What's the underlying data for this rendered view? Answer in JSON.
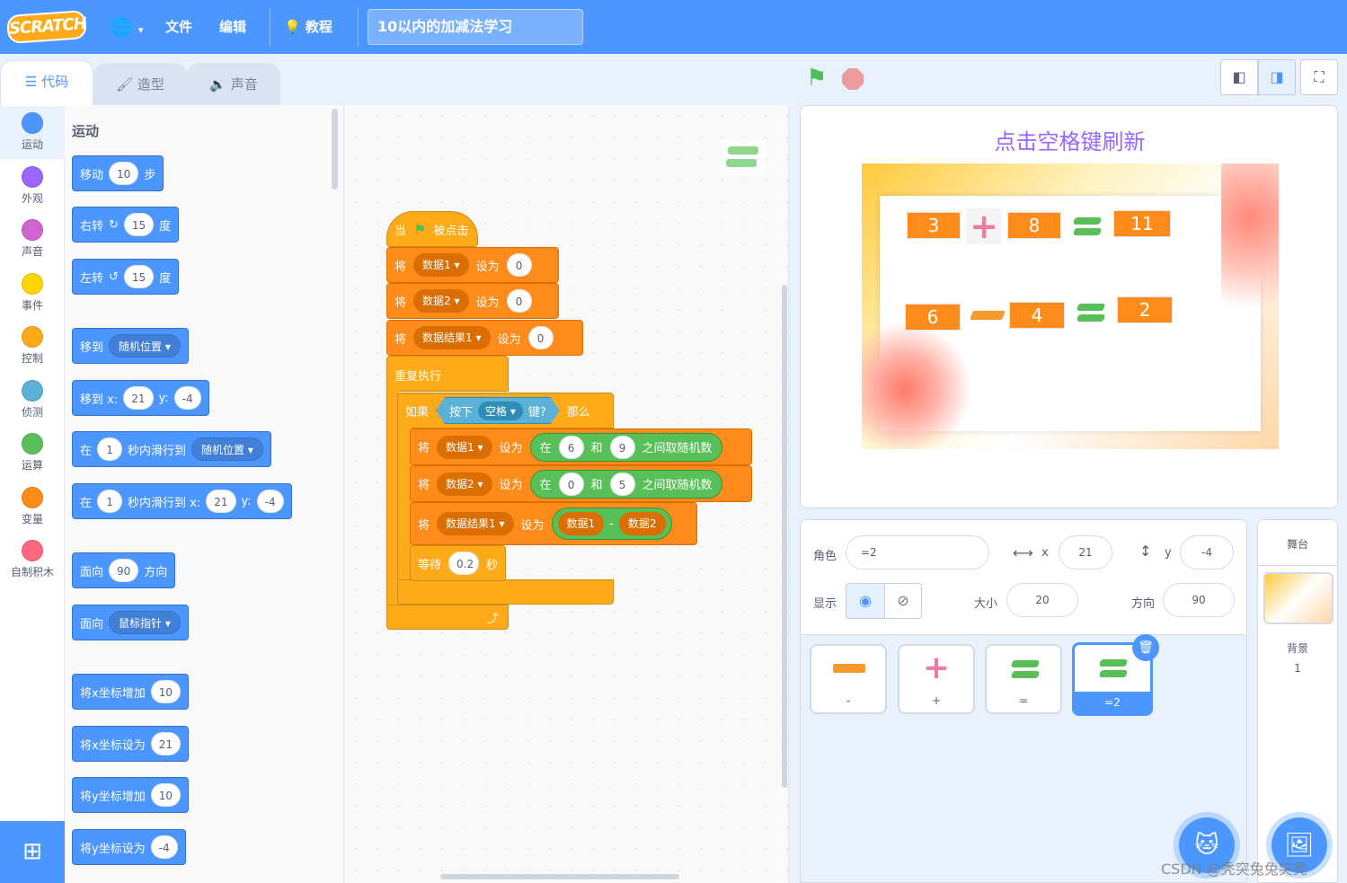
{
  "menu": {
    "logo": "SCRATCH",
    "file": "文件",
    "edit": "编辑",
    "tutorials": "教程",
    "project_title": "10以内的加减法学习"
  },
  "tabs": {
    "code": "代码",
    "costumes": "造型",
    "sounds": "声音"
  },
  "categories": [
    {
      "label": "运动",
      "color": "#4c97ff"
    },
    {
      "label": "外观",
      "color": "#9966ff"
    },
    {
      "label": "声音",
      "color": "#cf63cf"
    },
    {
      "label": "事件",
      "color": "#ffd500"
    },
    {
      "label": "控制",
      "color": "#ffab19"
    },
    {
      "label": "侦测",
      "color": "#5cb1d6"
    },
    {
      "label": "运算",
      "color": "#59c059"
    },
    {
      "label": "变量",
      "color": "#ff8c1a"
    },
    {
      "label": "自制积木",
      "color": "#ff6680"
    }
  ],
  "palette": {
    "title": "运动",
    "move": {
      "a": "移动",
      "v": "10",
      "b": "步"
    },
    "turn_right": {
      "a": "右转",
      "v": "15",
      "b": "度"
    },
    "turn_left": {
      "a": "左转",
      "v": "15",
      "b": "度"
    },
    "goto": {
      "a": "移到",
      "d": "随机位置"
    },
    "goto_xy": {
      "a": "移到 x:",
      "x": "21",
      "b": "y:",
      "y": "-4"
    },
    "glide": {
      "a": "在",
      "v": "1",
      "b": "秒内滑行到",
      "d": "随机位置"
    },
    "glide_xy": {
      "a": "在",
      "v": "1",
      "b": "秒内滑行到 x:",
      "x": "21",
      "c": "y:",
      "y": "-4"
    },
    "point_dir": {
      "a": "面向",
      "v": "90",
      "b": "方向"
    },
    "point_towards": {
      "a": "面向",
      "d": "鼠标指针"
    },
    "change_x": {
      "a": "将x坐标增加",
      "v": "10"
    },
    "set_x": {
      "a": "将x坐标设为",
      "v": "21"
    },
    "change_y": {
      "a": "将y坐标增加",
      "v": "10"
    },
    "set_y": {
      "a": "将y坐标设为",
      "v": "-4"
    }
  },
  "script": {
    "hat": {
      "a": "当",
      "b": "被点击"
    },
    "set1": {
      "a": "将",
      "var": "数据1",
      "b": "设为",
      "v": "0"
    },
    "set2": {
      "a": "将",
      "var": "数据2",
      "b": "设为",
      "v": "0"
    },
    "set3": {
      "a": "将",
      "var": "数据结果1",
      "b": "设为",
      "v": "0"
    },
    "forever": "重复执行",
    "if": {
      "a": "如果",
      "b": "按下",
      "key": "空格",
      "c": "键?",
      "d": "那么"
    },
    "rand1": {
      "a": "将",
      "var": "数据1",
      "b": "设为",
      "c": "在",
      "v1": "6",
      "d": "和",
      "v2": "9",
      "e": "之间取随机数"
    },
    "rand2": {
      "a": "将",
      "var": "数据2",
      "b": "设为",
      "c": "在",
      "v1": "0",
      "d": "和",
      "v2": "5",
      "e": "之间取随机数"
    },
    "calc": {
      "a": "将",
      "var": "数据结果1",
      "b": "设为",
      "left": "数据1",
      "op": "-",
      "right": "数据2"
    },
    "wait": {
      "a": "等待",
      "v": "0.2",
      "b": "秒"
    },
    "loop_arrow": "⤴"
  },
  "zoom": {
    "in": "⊕",
    "out": "⊖",
    "reset": "="
  },
  "stage": {
    "title": "点击空格键刷新",
    "row1": {
      "a": "3",
      "op": "+",
      "b": "8",
      "r": "11"
    },
    "row2": {
      "a": "6",
      "op": "-",
      "b": "4",
      "r": "2"
    }
  },
  "sprite_info": {
    "sprite_label": "角色",
    "sprite_name": "=2",
    "x_label": "x",
    "x": "21",
    "y_label": "y",
    "y": "-4",
    "show_label": "显示",
    "size_label": "大小",
    "size": "20",
    "direction_label": "方向",
    "direction": "90"
  },
  "sprites": [
    {
      "name": "-"
    },
    {
      "name": "+"
    },
    {
      "name": "="
    },
    {
      "name": "=2"
    }
  ],
  "stage_pane": {
    "title": "舞台",
    "backdrop_label": "背景",
    "backdrop_count": "1"
  },
  "watermark": "CSDN @秃突兔兔突秃"
}
